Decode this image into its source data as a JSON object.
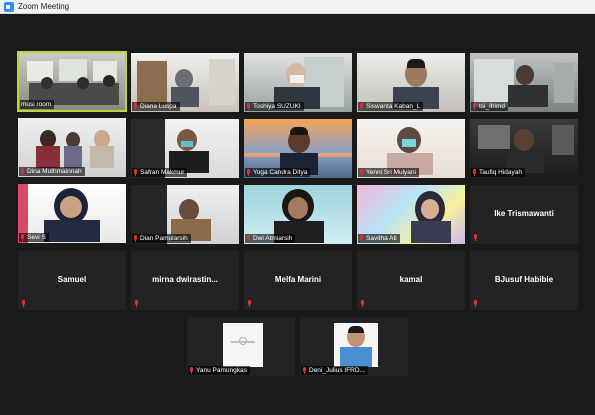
{
  "window": {
    "title": "Zoom Meeting",
    "app_icon": "zoom-app-icon"
  },
  "participants": [
    {
      "name": "musi room",
      "video": true,
      "muted": false,
      "active_speaker": true
    },
    {
      "name": "Diana Luspa",
      "video": true,
      "muted": true
    },
    {
      "name": "Toshiya SUZUKI",
      "video": true,
      "muted": true
    },
    {
      "name": "Siswanta Kaban_L",
      "video": true,
      "muted": true
    },
    {
      "name": "tsi_ifrimd",
      "video": true,
      "muted": true
    },
    {
      "name": "Dina Muthmainnah",
      "video": true,
      "muted": true
    },
    {
      "name": "Safran Makmur",
      "video": true,
      "muted": true
    },
    {
      "name": "Yoga Candra Ditya",
      "video": true,
      "muted": true
    },
    {
      "name": "Yenni Sri Mulyani",
      "video": true,
      "muted": true
    },
    {
      "name": "Taufiq Hidayah",
      "video": true,
      "muted": true
    },
    {
      "name": "Sevi S",
      "video": true,
      "muted": true
    },
    {
      "name": "Dian Pamularsih",
      "video": true,
      "muted": true
    },
    {
      "name": "Dwi Atmiarsih",
      "video": true,
      "muted": true
    },
    {
      "name": "Savitha Ati",
      "video": true,
      "muted": true
    },
    {
      "name": "Ike Trismawanti",
      "video": false,
      "muted": true
    },
    {
      "name": "Samuel",
      "video": false,
      "muted": true
    },
    {
      "name": "mirna dwirastin...",
      "video": false,
      "muted": true
    },
    {
      "name": "Melfa Marini",
      "video": false,
      "muted": true
    },
    {
      "name": "kamal",
      "video": false,
      "muted": true
    },
    {
      "name": "BJusuf Habibie",
      "video": false,
      "muted": true
    },
    {
      "name": "Yanu Pamungkas",
      "video": true,
      "muted": true
    },
    {
      "name": "Deni_Julius IFRD...",
      "video": true,
      "muted": true
    }
  ],
  "colors": {
    "active_border": "#b9d536",
    "mute": "#e02f2f",
    "tile_bg": "#232323",
    "stage_bg": "#1a1a1a"
  }
}
